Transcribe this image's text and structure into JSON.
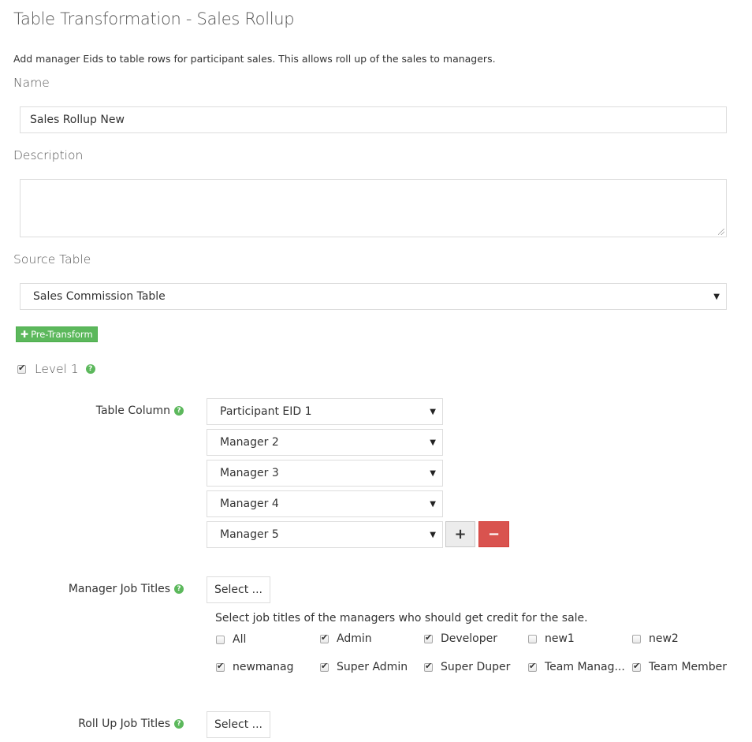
{
  "page": {
    "title": "Table Transformation - Sales Rollup",
    "intro": "Add manager Eids to table rows for participant sales. This allows roll up of the sales to managers."
  },
  "form": {
    "name_label": "Name",
    "name_value": "Sales Rollup New",
    "description_label": "Description",
    "description_value": "",
    "source_table_label": "Source Table",
    "source_table_value": "Sales Commission Table",
    "pre_transform_label": "Pre-Transform"
  },
  "level": {
    "label": "Level 1",
    "checked": true,
    "table_column_label": "Table Column",
    "columns": [
      "Participant EID 1",
      "Manager 2",
      "Manager 3",
      "Manager 4",
      "Manager 5"
    ],
    "add_label": "+",
    "remove_label": "−",
    "manager_job_titles_label": "Manager Job Titles",
    "select_label": "Select ...",
    "job_titles_hint": "Select job titles of the managers who should get credit for the sale.",
    "job_titles": [
      {
        "label": "All",
        "checked": false
      },
      {
        "label": "Admin",
        "checked": true
      },
      {
        "label": "Developer",
        "checked": true
      },
      {
        "label": "new1",
        "checked": false
      },
      {
        "label": "new2",
        "checked": false
      },
      {
        "label": "newmanag",
        "checked": true
      },
      {
        "label": "Super Admin",
        "checked": true
      },
      {
        "label": "Super Duper",
        "checked": true
      },
      {
        "label": "Team Manag...",
        "checked": true
      },
      {
        "label": "Team Member",
        "checked": true
      }
    ],
    "roll_up_job_titles_label": "Roll Up Job Titles",
    "roll_up_select_label": "Select ..."
  },
  "icons": {
    "help": "question-circle-icon",
    "caret": "caret-down-icon",
    "plus": "plus-icon",
    "minus": "minus-icon"
  },
  "colors": {
    "success": "#5cb85c",
    "danger": "#d9534f"
  }
}
